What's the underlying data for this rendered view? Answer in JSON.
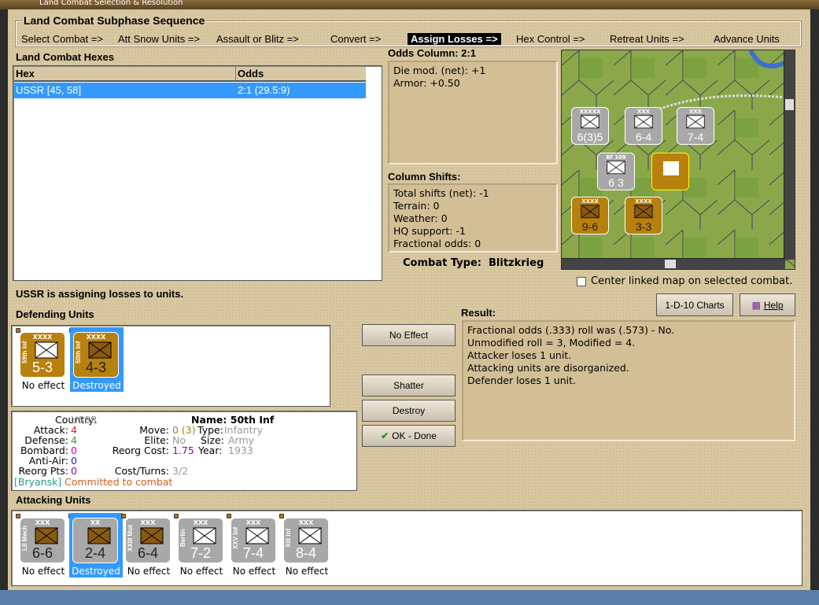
{
  "window": {
    "title": "Land Combat Selection & Resolution"
  },
  "subphase": {
    "title": "Land Combat Subphase Sequence",
    "steps": [
      "Select Combat =>",
      "Att Snow Units =>",
      "Assault or Blitz =>",
      "Convert =>",
      "Assign Losses =>",
      "Hex Control =>",
      "Retreat Units =>",
      "Advance Units"
    ],
    "active_index": 4
  },
  "hexes": {
    "title": "Land Combat Hexes",
    "columns": [
      "Hex",
      "Odds"
    ],
    "rows": [
      {
        "hex": "USSR [45, 58]",
        "odds": "2:1 (29.5:9)"
      }
    ]
  },
  "odds": {
    "title": "Odds Column: 2:1",
    "lines": [
      "Die mod. (net): +1",
      "Armor: +0.50"
    ]
  },
  "shifts": {
    "title": "Column Shifts:",
    "lines": [
      "Total shifts (net): -1",
      "Terrain: 0",
      "Weather: 0",
      "HQ support: -1",
      "Fractional odds: 0"
    ]
  },
  "combat_type": "Combat Type:  Blitzkrieg",
  "center_checkbox": {
    "label": "Center linked map on selected combat.",
    "checked": false
  },
  "status": "USSR is assigning losses to units.",
  "buttons": {
    "charts": "1-D-10 Charts",
    "help": "Help",
    "no_effect": "No Effect",
    "shatter": "Shatter",
    "destroy": "Destroy",
    "ok": "OK - Done"
  },
  "defending": {
    "title": "Defending Units",
    "units": [
      {
        "name": "59th Inf",
        "size": "XXXX",
        "value": "5-3",
        "result": "No effect",
        "selected": false
      },
      {
        "name": "50th Inf",
        "size": "XXXX",
        "value": "4-3",
        "result": "Destroyed",
        "selected": true
      }
    ]
  },
  "result": {
    "title": "Result:",
    "lines": [
      "Fractional odds (.333) roll was (.573)  - No.",
      "Unmodified roll = 3, Modified = 4.",
      "Attacker loses 1 unit.",
      "Attacking units are disorganized.",
      "Defender loses 1 unit."
    ]
  },
  "info": {
    "country_l": "Country:",
    "country": "USSR",
    "attack_l": "Attack:",
    "attack": "4",
    "defense_l": "Defense:",
    "defense": "4",
    "bombard_l": "Bombard:",
    "bombard": "0",
    "aa_l": "Anti-Air:",
    "aa": "0",
    "reorg_l": "Reorg Pts:",
    "reorg": "0",
    "name": "Name: 50th Inf",
    "move_l": "Move:",
    "move": "0 (3)",
    "type_l": "Type:",
    "type": "Infantry",
    "elite_l": "Elite:",
    "elite": "No",
    "size_l": "Size:",
    "size": "Army",
    "rcost_l": "Reorg Cost:",
    "rcost": "1.75",
    "year_l": "Year:",
    "year": "1933",
    "cost_l": "Cost/Turns:",
    "cost": "3/2",
    "hq": "[Bryansk]",
    "status": "Committed to combat"
  },
  "attacking": {
    "title": "Attacking Units",
    "units": [
      {
        "name": "LII Mech",
        "size": "XXX",
        "value": "6-6",
        "result": "No effect",
        "selected": false
      },
      {
        "name": "",
        "size": "XX",
        "value": "2-4",
        "result": "Destroyed",
        "selected": true
      },
      {
        "name": "XXIII Mot",
        "size": "XXX",
        "value": "6-4",
        "result": "No effect",
        "selected": false
      },
      {
        "name": "Berlin",
        "size": "XXX",
        "value": "7-2",
        "result": "No effect",
        "selected": false
      },
      {
        "name": "XXV Inf",
        "size": "XXX",
        "value": "7-4",
        "result": "No effect",
        "selected": false
      },
      {
        "name": "XIII Inf",
        "size": "XXX",
        "value": "8-4",
        "result": "No effect",
        "selected": false
      }
    ]
  },
  "map": {
    "counters": [
      {
        "size": "XXXXX",
        "value": "6(3)5",
        "side": "axis"
      },
      {
        "size": "XXX",
        "value": "6-4",
        "side": "axis"
      },
      {
        "size": "XXX",
        "value": "7-4",
        "side": "axis"
      },
      {
        "size": "XXXX",
        "value": "9-6",
        "side": "ussr"
      },
      {
        "size": "XXXX",
        "value": "3-3",
        "side": "ussr"
      },
      {
        "size": "Bf 109",
        "value": "6  3",
        "side": "axis"
      }
    ]
  },
  "colors": {
    "ussr": "#b8800c",
    "axis": "#a8a8a8",
    "selection": "#3399ff"
  }
}
